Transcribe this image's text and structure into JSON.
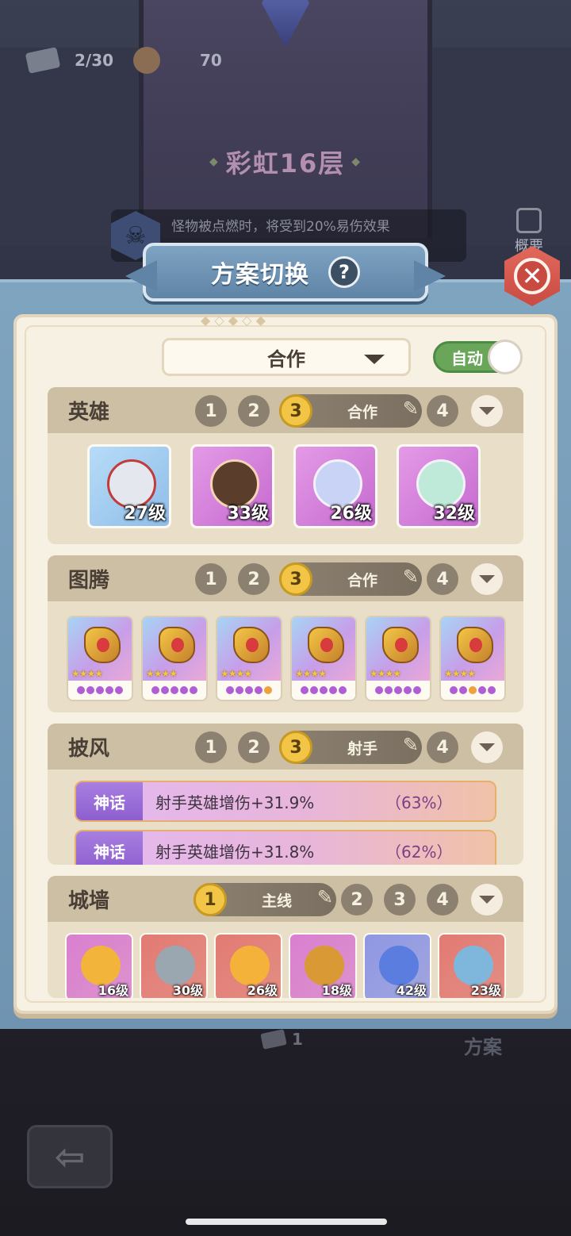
{
  "hud": {
    "ticket_count": "2/30",
    "food_count": "70",
    "floor_title": "彩虹16层",
    "monster_tip": "怪物被点燃时，将受到20%易伤效果",
    "overview_label": "概要"
  },
  "modal": {
    "title": "方案切换",
    "help_label": "?",
    "close_label": "✕",
    "mode_value": "合作",
    "auto_label": "自动"
  },
  "sections": {
    "heroes": {
      "title": "英雄",
      "slots": [
        "1",
        "2",
        "3",
        "4"
      ],
      "active_slot": "3",
      "active_name": "合作",
      "cards": [
        {
          "level": "27级",
          "bg": "#9fcbef"
        },
        {
          "level": "33级",
          "bg": "#d57fd9"
        },
        {
          "level": "26级",
          "bg": "#d57fd9"
        },
        {
          "level": "32级",
          "bg": "#d57fd9"
        }
      ]
    },
    "totems": {
      "title": "图腾",
      "slots": [
        "1",
        "2",
        "3",
        "4"
      ],
      "active_slot": "3",
      "active_name": "合作",
      "cards": [
        {
          "stars": "★★★★",
          "dots": "ppppp"
        },
        {
          "stars": "★★★★",
          "dots": "ppppp"
        },
        {
          "stars": "★★★★",
          "dots": "ppppo"
        },
        {
          "stars": "★★★★",
          "dots": "ppppp"
        },
        {
          "stars": "★★★★",
          "dots": "ppppp"
        },
        {
          "stars": "★★★★",
          "dots": "ppopp"
        }
      ]
    },
    "cloak": {
      "title": "披风",
      "slots": [
        "1",
        "2",
        "3",
        "4"
      ],
      "active_slot": "3",
      "active_name": "射手",
      "rows": [
        {
          "tag": "神话",
          "desc": "射手英雄增伤+31.9%",
          "pct": "（63%）"
        },
        {
          "tag": "神话",
          "desc": "射手英雄增伤+31.8%",
          "pct": "（62%）"
        }
      ]
    },
    "wall": {
      "title": "城墙",
      "slots": [
        "1",
        "2",
        "3",
        "4"
      ],
      "active_slot": "1",
      "active_name": "主线",
      "cards": [
        {
          "level": "16级",
          "bg": "#d97fcf"
        },
        {
          "level": "30级",
          "bg": "#e27a73"
        },
        {
          "level": "26级",
          "bg": "#e27a73"
        },
        {
          "level": "18级",
          "bg": "#d97fcf"
        },
        {
          "level": "42级",
          "bg": "#8f97e3"
        },
        {
          "level": "23级",
          "bg": "#e27a73"
        }
      ]
    }
  },
  "footer": {
    "plan_count": "1",
    "plan_label": "方案",
    "back_label": "⇦"
  }
}
